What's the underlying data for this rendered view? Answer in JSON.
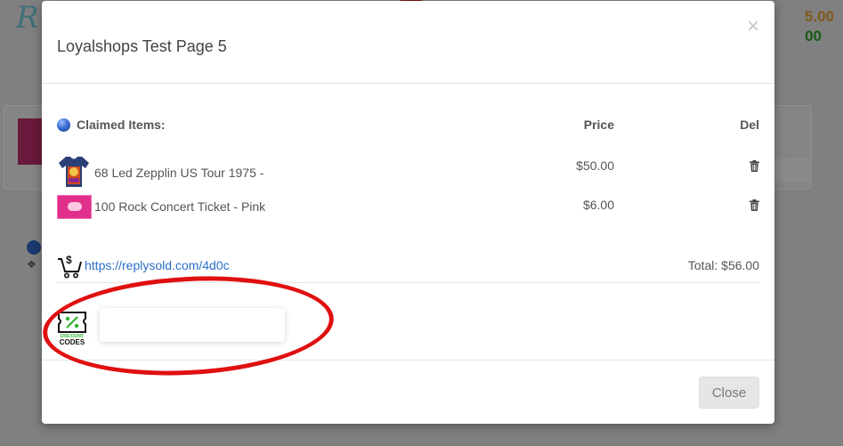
{
  "background": {
    "logo_text": "R",
    "price_top": "5.00",
    "price_bottom": "00"
  },
  "modal": {
    "title": "Loyalshops Test Page 5",
    "close_symbol": "×",
    "table": {
      "claimed_label": "Claimed Items:",
      "price_header": "Price",
      "del_header": "Del"
    },
    "items": [
      {
        "name": "68 Led Zepplin US Tour 1975 -",
        "price": "$50.00",
        "thumb_icon": "tshirt-thumbnail"
      },
      {
        "name": "100 Rock Concert Ticket - Pink",
        "price": "$6.00",
        "thumb_icon": "ticket-thumbnail"
      }
    ],
    "checkout_link": "https://replysold.com/4d0c",
    "total": "Total: $56.00",
    "discount": {
      "icon_lines": [
        "DISCOUNT",
        "CODES"
      ],
      "input_value": "",
      "input_placeholder": ""
    },
    "close_button": "Close"
  },
  "annotation": {
    "color": "#e01010"
  }
}
